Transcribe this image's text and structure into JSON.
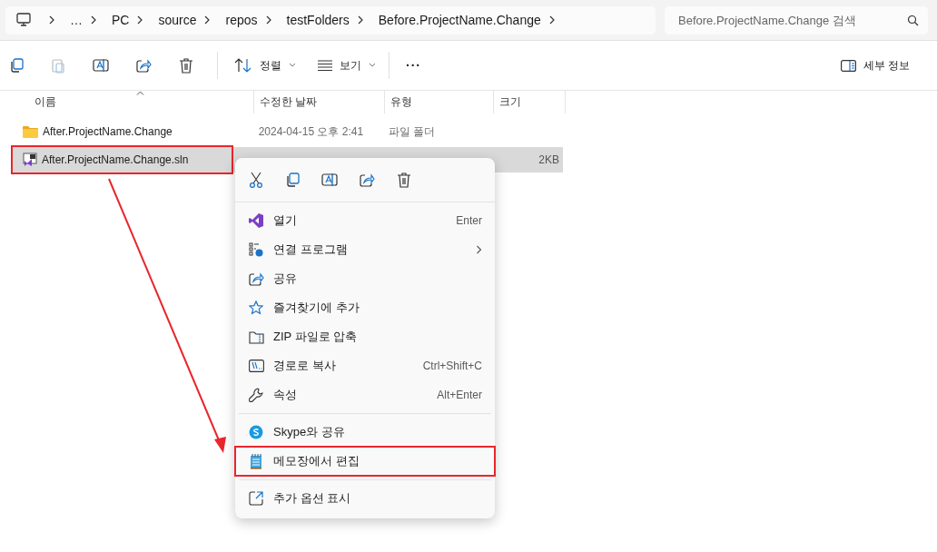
{
  "breadcrumb": [
    "…",
    "PC",
    "source",
    "repos",
    "testFolders",
    "Before.ProjectName.Change"
  ],
  "search": {
    "placeholder": "Before.ProjectName.Change 검색"
  },
  "toolbar": {
    "sort": "정렬",
    "view": "보기",
    "more": "···",
    "details": "세부 정보"
  },
  "table": {
    "columns": [
      "이름",
      "수정한 날짜",
      "유형",
      "크기"
    ],
    "rows": [
      {
        "name": "After.ProjectName.Change",
        "date": "2024-04-15 오후 2:41",
        "type": "파일 폴더",
        "kind": "folder",
        "selected": false,
        "highlighted": false
      },
      {
        "name": "After.ProjectName.Change.sln",
        "size": "2KB",
        "kind": "solution",
        "selected": true,
        "highlighted": true
      }
    ]
  },
  "context_menu": {
    "items": [
      {
        "kind": "item",
        "label": "열기",
        "shortcut": "Enter",
        "submenu": false,
        "highlighted": false
      },
      {
        "kind": "item",
        "label": "연결 프로그램",
        "submenu": true,
        "highlighted": false
      },
      {
        "kind": "item",
        "label": "공유",
        "submenu": false,
        "highlighted": false
      },
      {
        "kind": "item",
        "label": "즐겨찾기에 추가",
        "submenu": false,
        "highlighted": false
      },
      {
        "kind": "item",
        "label": "ZIP 파일로 압축",
        "submenu": false,
        "highlighted": false
      },
      {
        "kind": "item",
        "label": "경로로 복사",
        "shortcut": "Ctrl+Shift+C",
        "submenu": false,
        "highlighted": false
      },
      {
        "kind": "item",
        "label": "속성",
        "shortcut": "Alt+Enter",
        "submenu": false,
        "highlighted": false
      },
      {
        "kind": "divider"
      },
      {
        "kind": "item",
        "label": "Skype와 공유",
        "submenu": false,
        "highlighted": false
      },
      {
        "kind": "item",
        "label": "메모장에서 편집",
        "submenu": false,
        "highlighted": true
      },
      {
        "kind": "divider"
      },
      {
        "kind": "item",
        "label": "추가 옵션 표시",
        "submenu": false,
        "highlighted": false
      }
    ]
  }
}
